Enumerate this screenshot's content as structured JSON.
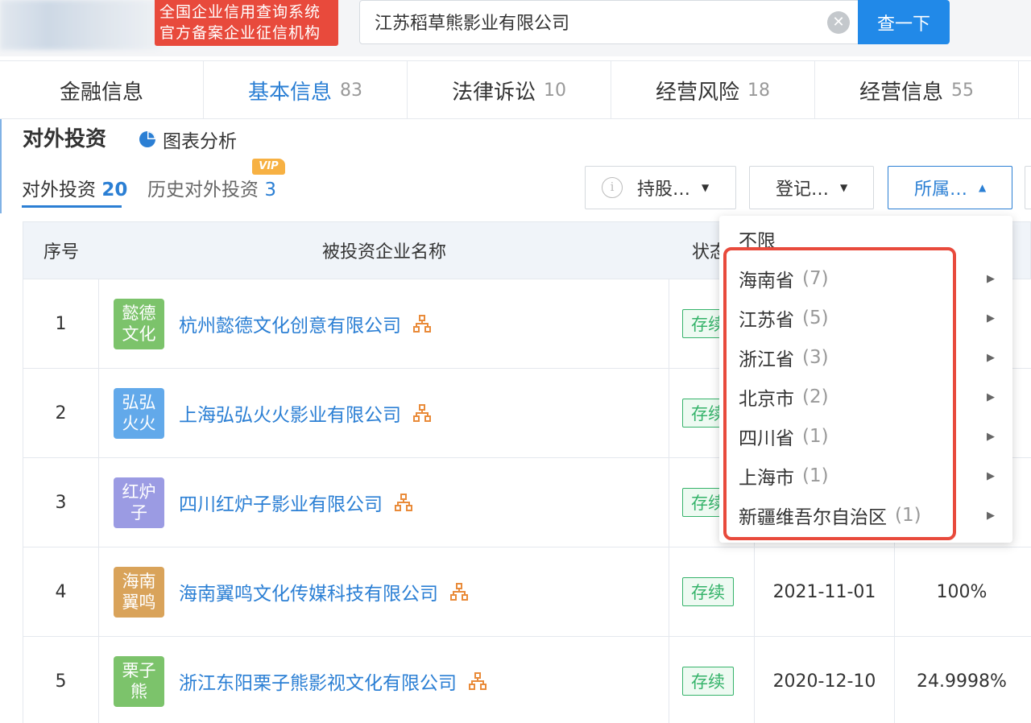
{
  "header": {
    "badge_line1": "全国企业信用查询系统",
    "badge_line2": "官方备案企业征信机构",
    "search_value": "江苏稻草熊影业有限公司",
    "search_button": "查一下"
  },
  "main_tabs": [
    {
      "label": "金融信息",
      "count": ""
    },
    {
      "label": "基本信息",
      "count": "83"
    },
    {
      "label": "法律诉讼",
      "count": "10"
    },
    {
      "label": "经营风险",
      "count": "18"
    },
    {
      "label": "经营信息",
      "count": "55"
    }
  ],
  "section": {
    "title": "对外投资",
    "chart_link": "图表分析",
    "subtab_current": "对外投资",
    "subtab_current_count": "20",
    "subtab_history": "历史对外投资",
    "subtab_history_count": "3",
    "vip": "VIP"
  },
  "filters": {
    "holding": "持股…",
    "register": "登记…",
    "region": "所属…"
  },
  "table": {
    "headers": {
      "index": "序号",
      "name": "被投资企业名称",
      "status": "状态"
    },
    "rows": [
      {
        "index": "1",
        "logo_l1": "懿德",
        "logo_l2": "文化",
        "logo_color": "#7cc36b",
        "name": "杭州懿德文化创意有限公司",
        "status": "存续",
        "date": "",
        "ratio": ""
      },
      {
        "index": "2",
        "logo_l1": "弘弘",
        "logo_l2": "火火",
        "logo_color": "#62a9ea",
        "name": "上海弘弘火火影业有限公司",
        "status": "存续",
        "date": "",
        "ratio": ""
      },
      {
        "index": "3",
        "logo_l1": "红炉",
        "logo_l2": "子",
        "logo_color": "#9b9be3",
        "name": "四川红炉子影业有限公司",
        "status": "存续",
        "date": "",
        "ratio": ""
      },
      {
        "index": "4",
        "logo_l1": "海南",
        "logo_l2": "翼鸣",
        "logo_color": "#d9a35a",
        "name": "海南翼鸣文化传媒科技有限公司",
        "status": "存续",
        "date": "2021-11-01",
        "ratio": "100%"
      },
      {
        "index": "5",
        "logo_l1": "栗子",
        "logo_l2": "熊",
        "logo_color": "#7cc36b",
        "name": "浙江东阳栗子熊影视文化有限公司",
        "status": "存续",
        "date": "2020-12-10",
        "ratio": "24.9998%"
      }
    ]
  },
  "dropdown": {
    "all": "不限",
    "items": [
      {
        "label": "海南省",
        "count": "(7)"
      },
      {
        "label": "江苏省",
        "count": "(5)"
      },
      {
        "label": "浙江省",
        "count": "(3)"
      },
      {
        "label": "北京市",
        "count": "(2)"
      },
      {
        "label": "四川省",
        "count": "(1)"
      },
      {
        "label": "上海市",
        "count": "(1)"
      },
      {
        "label": "新疆维吾尔自治区",
        "count": "(1)"
      }
    ]
  },
  "colors": {
    "accent": "#2b7fd4",
    "search_button": "#2189e8",
    "badge_red": "#e84a3c",
    "status_green": "#35b36a",
    "vip": "#f7b143"
  }
}
